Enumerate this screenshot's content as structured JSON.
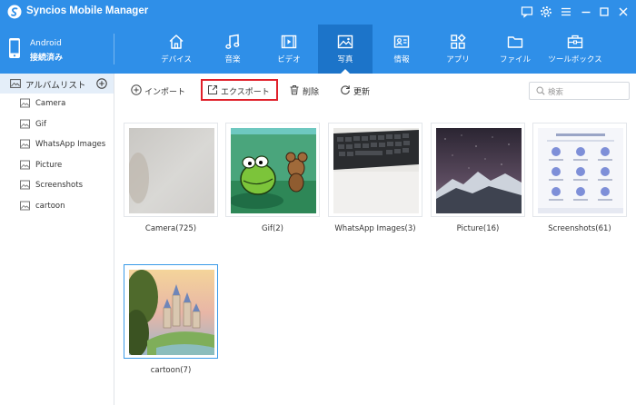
{
  "app": {
    "title": "Syncios Mobile Manager"
  },
  "device": {
    "name": "Android",
    "status": "接続済み"
  },
  "nav": {
    "tabs": [
      {
        "label": "デバイス",
        "icon": "home-icon"
      },
      {
        "label": "音楽",
        "icon": "music-icon"
      },
      {
        "label": "ビデオ",
        "icon": "video-icon"
      },
      {
        "label": "写真",
        "icon": "photo-icon",
        "active": true
      },
      {
        "label": "情報",
        "icon": "contact-card-icon"
      },
      {
        "label": "アプリ",
        "icon": "apps-icon"
      },
      {
        "label": "ファイル",
        "icon": "folder-icon"
      },
      {
        "label": "ツールボックス",
        "icon": "toolbox-icon"
      }
    ]
  },
  "sidebar": {
    "header": "アルバムリスト",
    "items": [
      {
        "label": "Camera"
      },
      {
        "label": "Gif"
      },
      {
        "label": "WhatsApp Images"
      },
      {
        "label": "Picture"
      },
      {
        "label": "Screenshots"
      },
      {
        "label": "cartoon"
      }
    ]
  },
  "toolbar": {
    "import_label": "インポート",
    "export_label": "エクスポート",
    "delete_label": "削除",
    "refresh_label": "更新"
  },
  "search": {
    "placeholder": "検索"
  },
  "albums": [
    {
      "label": "Camera(725)"
    },
    {
      "label": "Gif(2)"
    },
    {
      "label": "WhatsApp Images(3)"
    },
    {
      "label": "Picture(16)"
    },
    {
      "label": "Screenshots(61)"
    },
    {
      "label": "cartoon(7)",
      "selected": true
    }
  ],
  "colors": {
    "brand": "#2f8fe8",
    "active_tab": "#1c74c9",
    "highlight": "#e0202a",
    "selection": "#3a9ae8"
  }
}
